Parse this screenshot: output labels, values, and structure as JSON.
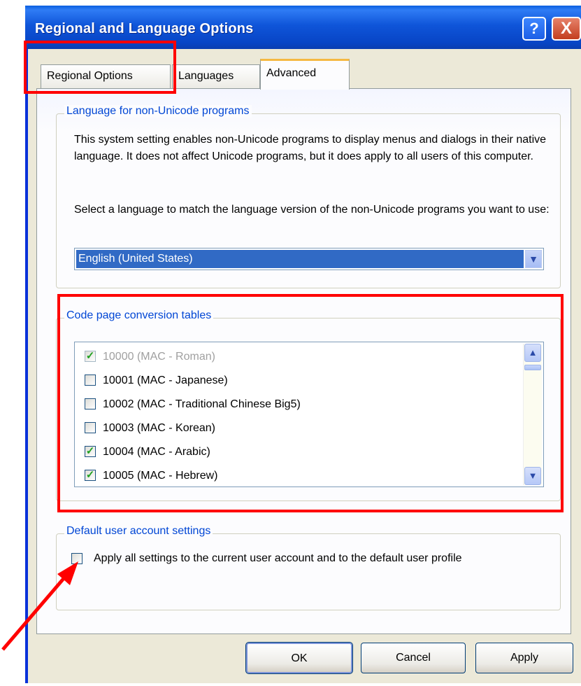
{
  "window": {
    "title": "Regional and Language Options",
    "help_label": "?",
    "close_label": "X"
  },
  "tabs": [
    {
      "label": "Regional Options"
    },
    {
      "label": "Languages"
    },
    {
      "label": "Advanced"
    }
  ],
  "non_unicode": {
    "legend": "Language for non-Unicode programs",
    "description": "This system setting enables non-Unicode programs to display menus and dialogs in their native language. It does not affect Unicode programs, but it does apply to all users of this computer.",
    "select_prompt": "Select a language to match the language version of the non-Unicode programs you want to use:",
    "selected_language": "English (United States)"
  },
  "code_pages": {
    "legend": "Code page conversion tables",
    "items": [
      {
        "label": "10000 (MAC - Roman)",
        "checked": true,
        "disabled": true
      },
      {
        "label": "10001 (MAC - Japanese)",
        "checked": false,
        "disabled": false
      },
      {
        "label": "10002 (MAC - Traditional Chinese Big5)",
        "checked": false,
        "disabled": false
      },
      {
        "label": "10003 (MAC - Korean)",
        "checked": false,
        "disabled": false
      },
      {
        "label": "10004 (MAC - Arabic)",
        "checked": true,
        "disabled": false
      },
      {
        "label": "10005 (MAC - Hebrew)",
        "checked": true,
        "disabled": false
      }
    ]
  },
  "default_user": {
    "legend": "Default user account settings",
    "checkbox_label": "Apply all settings to the current user account and to the default user profile",
    "checked": false
  },
  "buttons": {
    "ok": "OK",
    "cancel": "Cancel",
    "apply": "Apply"
  },
  "colors": {
    "title_bar": "#0a5fe0",
    "legend_text": "#0046d5",
    "highlight": "#ff0000",
    "selection": "#316ac5"
  }
}
